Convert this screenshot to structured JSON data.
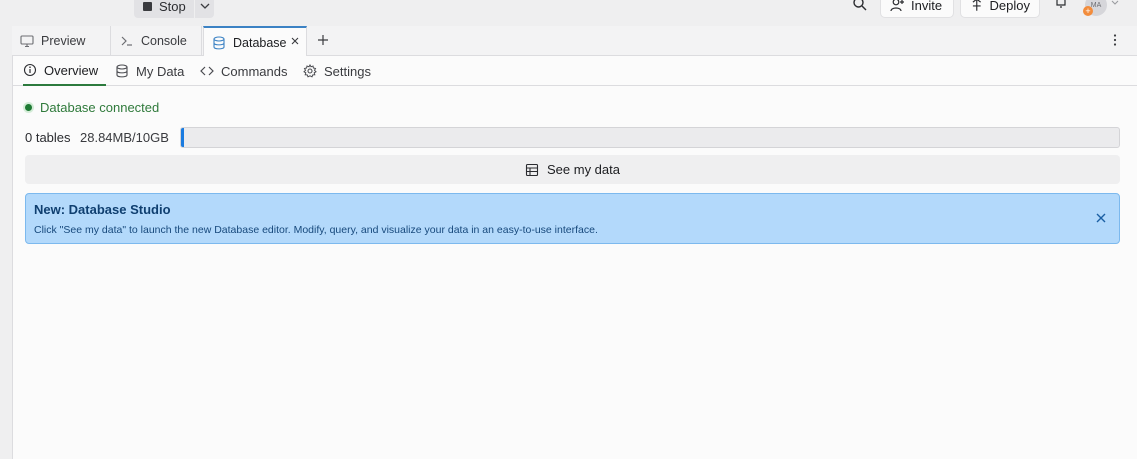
{
  "topbar": {
    "stop_label": "Stop",
    "invite_label": "Invite",
    "deploy_label": "Deploy",
    "avatar_initials": "MA",
    "avatar_badge": "+"
  },
  "tabs": [
    {
      "label": "Preview",
      "icon": "monitor-icon"
    },
    {
      "label": "Console",
      "icon": "terminal-icon"
    },
    {
      "label": "Database",
      "icon": "database-icon",
      "active": true
    }
  ],
  "subtabs": [
    {
      "label": "Overview",
      "icon": "info-icon",
      "active": true
    },
    {
      "label": "My Data",
      "icon": "database-icon"
    },
    {
      "label": "Commands",
      "icon": "code-icon"
    },
    {
      "label": "Settings",
      "icon": "gear-icon"
    }
  ],
  "overview": {
    "status_text": "Database connected",
    "tables_count": "0 tables",
    "storage_used": "28.84MB/10GB",
    "usage_fraction": 0.0029,
    "see_data_label": "See my data"
  },
  "banner": {
    "title": "New: Database Studio",
    "text": "Click \"See my data\" to launch the new Database editor. Modify, query, and visualize your data in an easy-to-use interface."
  },
  "colors": {
    "accent_blue": "#1a7be0",
    "status_green": "#1e7a34",
    "banner_bg": "#b3d9fb"
  }
}
